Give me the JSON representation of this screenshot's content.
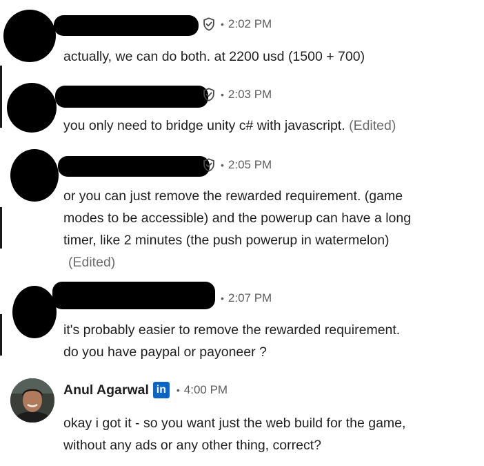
{
  "messages": [
    {
      "time": "2:02 PM",
      "text": "actually, we can do both. at 2200 usd (1500 + 700)",
      "edited": ""
    },
    {
      "time": "2:03 PM",
      "text": "you only need to bridge unity c# with javascript.",
      "edited": "(Edited)"
    },
    {
      "time": "2:05 PM",
      "text_lines": [
        "or you can just remove the rewarded requirement. (game",
        "modes to be accessible) and the powerup can have a long",
        "timer, like 2 minutes (the push powerup in watermelon)"
      ],
      "edited": "(Edited)"
    },
    {
      "time": "2:07 PM",
      "text_lines": [
        "it's probably easier to remove the rewarded requirement.",
        "do you have paypal or payoneer ?"
      ],
      "edited": ""
    },
    {
      "sender": "Anul Agarwal",
      "badge": "in",
      "time": "4:00 PM",
      "text_lines": [
        "okay i got it - so you want just the web build for the game,",
        "without any ads or any other thing, correct?"
      ]
    }
  ],
  "separator": "•",
  "icons": {
    "verified": "shield-check-icon",
    "linkedin": "linkedin-badge-icon"
  },
  "colors": {
    "linkedin_blue": "#0a66c2",
    "meta_gray": "#5e5e5e",
    "text": "#1f1f1f"
  }
}
